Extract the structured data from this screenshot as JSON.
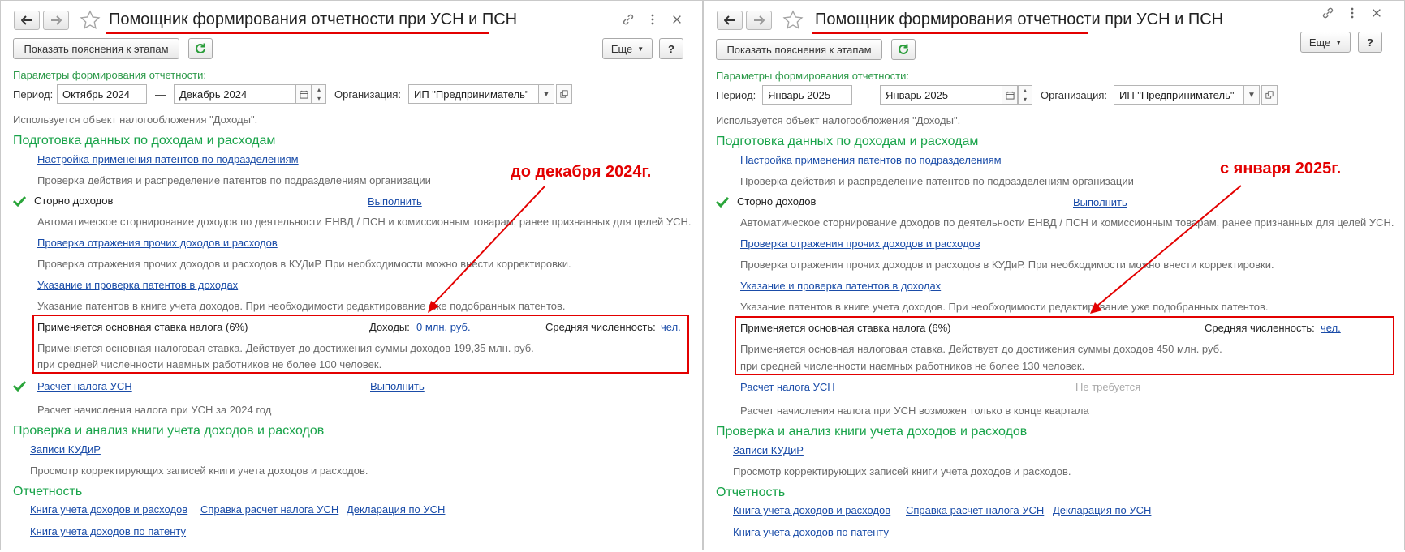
{
  "window": {
    "title": "Помощник формирования отчетности при УСН и ПСН"
  },
  "icons": {
    "back": "arrow-left-icon",
    "forward": "arrow-right-icon",
    "favorite": "star-icon",
    "link": "link-icon",
    "menu": "more-vertical-icon",
    "close": "close-icon",
    "refresh": "refresh-icon",
    "check": "check-icon",
    "calendar": "calendar-icon",
    "dropdown": "chevron-down-icon",
    "open": "open-icon"
  },
  "colors": {
    "accent_green": "#19a34a",
    "link_blue": "#1a4ca8",
    "annotation_red": "#e30000"
  },
  "left": {
    "toolbar": {
      "show_hints": "Показать пояснения к этапам",
      "more": "Еще",
      "help": "?"
    },
    "params": {
      "header": "Параметры формирования отчетности:",
      "period_label": "Период:",
      "period_from": "Октябрь 2024",
      "dash": "—",
      "period_to": "Декабрь 2024",
      "org_label": "Организация:",
      "org_value": "ИП \"Предприниматель\"",
      "tax_object": "Используется объект налогообложения \"Доходы\"."
    },
    "prep": {
      "header": "Подготовка данных по доходам и расходам",
      "patents_link": "Настройка применения патентов по подразделениям",
      "patents_desc": "Проверка действия и распределение патентов по подразделениям организации",
      "storno_label": "Сторно доходов",
      "storno_action": "Выполнить",
      "storno_desc": "Автоматическое сторнирование доходов по деятельности ЕНВД / ПСН и комиссионным товарам, ранее признанных для целей УСН.",
      "other_link": "Проверка отражения прочих доходов и расходов",
      "other_desc": "Проверка отражения прочих доходов и расходов в КУДиР. При необходимости можно внести корректировки.",
      "patent_income_link": "Указание и проверка патентов в доходах",
      "patent_income_desc": "Указание патентов в книге учета доходов. При необходимости редактирование уже подобранных патентов.",
      "rate_label": "Применяется основная ставка налога (6%)",
      "income_label": "Доходы:",
      "income_value": "0 млн. руб.",
      "staff_label": "Средняя численность:",
      "staff_value": "чел.",
      "rate_desc1": "Применяется основная налоговая ставка. Действует до достижения суммы доходов 199,35 млн. руб.",
      "rate_desc2": "при средней численности наемных работников не более 100 человек.",
      "tax_calc_link": "Расчет налога УСН",
      "tax_calc_action": "Выполнить",
      "tax_calc_desc": "Расчет начисления налога при УСН за 2024 год"
    },
    "book": {
      "header": "Проверка и анализ книги учета доходов и расходов",
      "kudir_link": "Записи КУДиР",
      "kudir_desc": "Просмотр корректирующих записей книги учета доходов и расходов."
    },
    "reports": {
      "header": "Отчетность",
      "book_link": "Книга учета доходов и расходов",
      "certificate_link": "Справка расчет налога УСН",
      "declaration_link": "Декларация по УСН",
      "patent_book_link": "Книга учета доходов по патенту"
    },
    "annotation": "до декабря 2024г."
  },
  "right": {
    "toolbar": {
      "show_hints": "Показать пояснения к этапам",
      "more": "Еще",
      "help": "?"
    },
    "params": {
      "header": "Параметры формирования отчетности:",
      "period_label": "Период:",
      "period_from": "Январь 2025",
      "dash": "—",
      "period_to": "Январь 2025",
      "org_label": "Организация:",
      "org_value": "ИП \"Предприниматель\"",
      "tax_object": "Используется объект налогообложения \"Доходы\"."
    },
    "prep": {
      "header": "Подготовка данных по доходам и расходам",
      "patents_link": "Настройка применения патентов по подразделениям",
      "patents_desc": "Проверка действия и распределение патентов по подразделениям организации",
      "storno_label": "Сторно доходов",
      "storno_action": "Выполнить",
      "storno_desc": "Автоматическое сторнирование доходов по деятельности ЕНВД / ПСН и комиссионным товарам, ранее признанных для целей УСН.",
      "other_link": "Проверка отражения прочих доходов и расходов",
      "other_desc": "Проверка отражения прочих доходов и расходов в КУДиР. При необходимости можно внести корректировки.",
      "patent_income_link": "Указание и проверка патентов в доходах",
      "patent_income_desc": "Указание патентов в книге учета доходов. При необходимости редактирование уже подобранных патентов.",
      "rate_label": "Применяется основная ставка налога (6%)",
      "staff_label": "Средняя численность:",
      "staff_value": "чел.",
      "rate_desc1": "Применяется основная налоговая ставка. Действует до достижения суммы доходов 450 млн. руб.",
      "rate_desc2": "при средней численности наемных работников не более 130 человек.",
      "tax_calc_link": "Расчет налога УСН",
      "tax_calc_status": "Не требуется",
      "tax_calc_desc": "Расчет начисления налога при УСН возможен только в конце квартала"
    },
    "book": {
      "header": "Проверка и анализ книги учета доходов и расходов",
      "kudir_link": "Записи КУДиР",
      "kudir_desc": "Просмотр корректирующих записей книги учета доходов и расходов."
    },
    "reports": {
      "header": "Отчетность",
      "book_link": "Книга учета доходов и расходов",
      "certificate_link": "Справка расчет налога УСН",
      "declaration_link": "Декларация по УСН",
      "patent_book_link": "Книга учета доходов по патенту"
    },
    "annotation": "с января 2025г."
  }
}
